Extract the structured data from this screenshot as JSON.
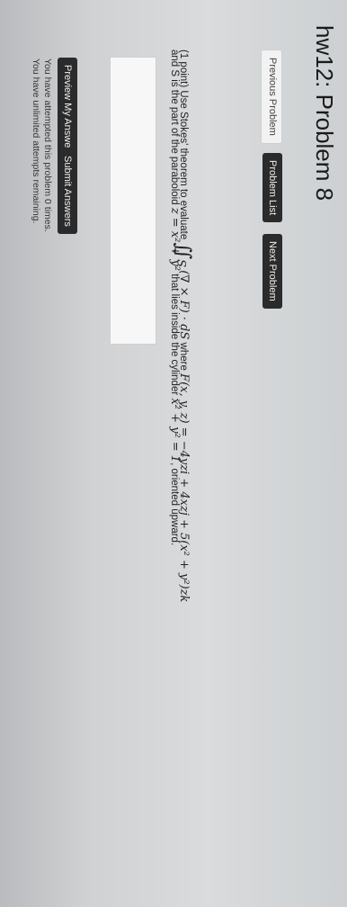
{
  "page": {
    "title": "hw12: Problem 8"
  },
  "nav": {
    "previous": "Previous Problem",
    "list": "Problem List",
    "next": "Next Problem"
  },
  "problem": {
    "intro": "(1 point) Use Stokes' theorem to evaluate",
    "integral_symbol": "∬",
    "integral_sub": "S",
    "integrand": "(∇ × F) · dS",
    "where": "where",
    "field": "F(x, y, z) = −4yzi + 4xzj + 5(x² + y²)zk",
    "surface_prefix": "and S is the part of the paraboloid",
    "surface_eq": "z = x² + y²",
    "surface_mid": "that lies inside the cylinder",
    "cylinder_eq": "x² + y² = 1",
    "surface_suffix": ", oriented upward."
  },
  "actions": {
    "preview": "Preview My Answers",
    "submit": "Submit Answers"
  },
  "status": {
    "attempts": "You have attempted this problem 0 times.",
    "remaining": "You have unlimited attempts remaining."
  }
}
